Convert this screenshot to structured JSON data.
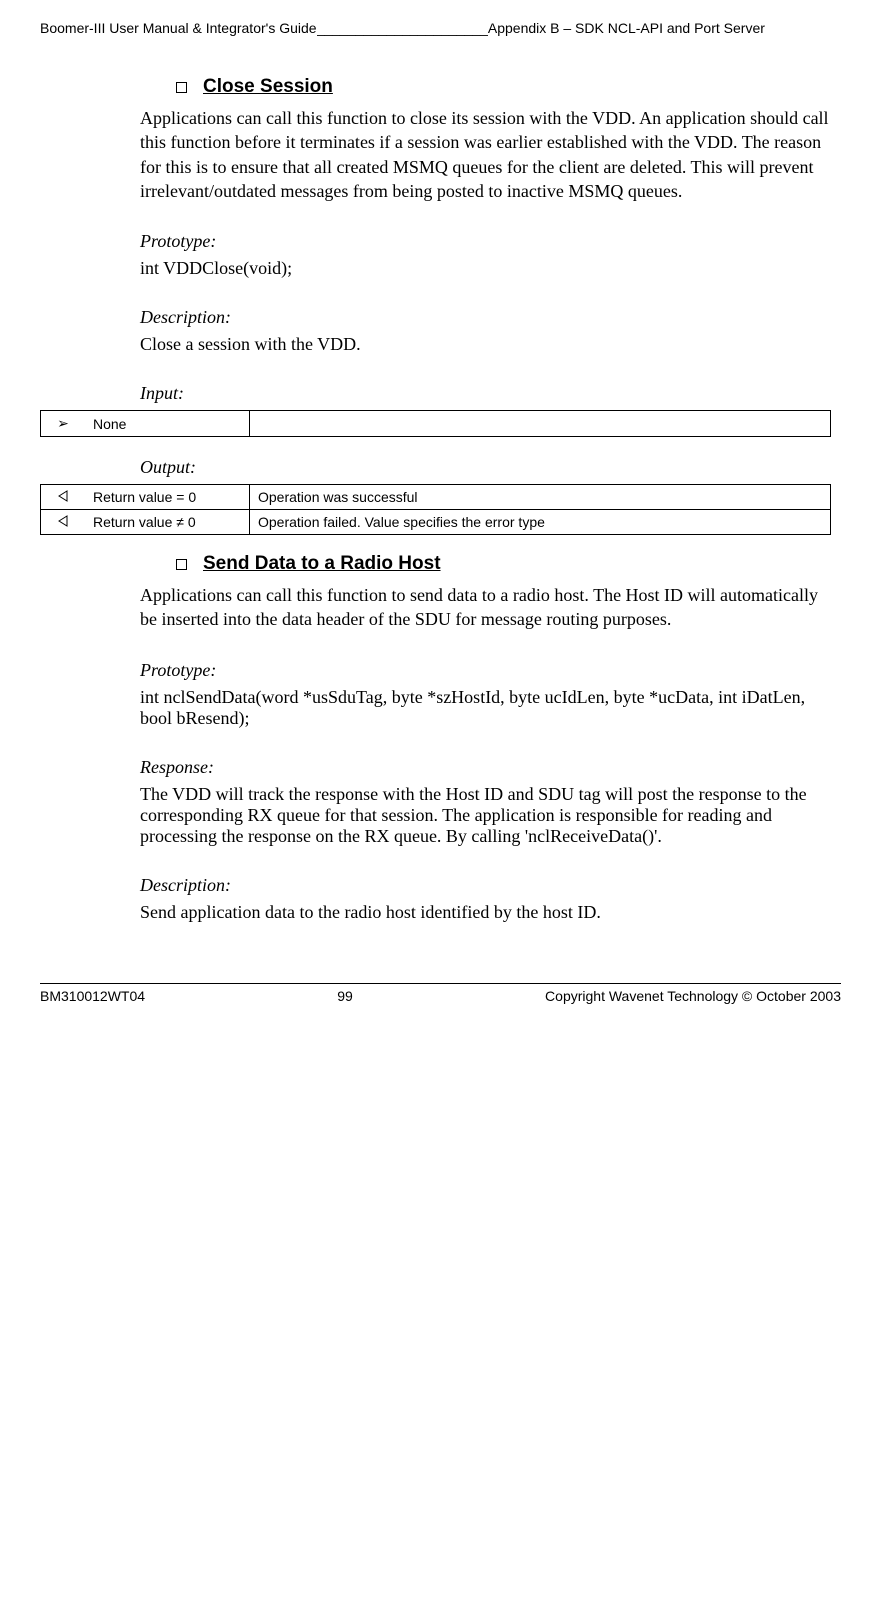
{
  "header": {
    "left": "Boomer-III User Manual & Integrator's Guide",
    "fill": "______________________",
    "right": "Appendix B – SDK NCL-API and Port Server"
  },
  "section1": {
    "title": "Close Session",
    "body": "Applications can call this function to close its session with the VDD. An application should call this function before it terminates if a session was earlier established with the VDD.  The reason for this is to ensure that all created MSMQ queues for the client are deleted. This will prevent irrelevant/outdated messages from being posted to inactive MSMQ queues.",
    "prototype_label": "Prototype:",
    "prototype": "int VDDClose(void);",
    "description_label": "Description:",
    "description": "Close a session with the VDD.",
    "input_label": "Input",
    "output_label": "Output",
    "input_rows": [
      {
        "arrow": "➢",
        "key": "None",
        "val": ""
      }
    ],
    "output_rows": [
      {
        "arrow": "",
        "key": "Return value = 0",
        "val": "Operation was successful"
      },
      {
        "arrow": "",
        "key": "Return value  ≠ 0",
        "val": "Operation failed. Value specifies the error type"
      }
    ]
  },
  "section2": {
    "title": "Send Data to a Radio Host",
    "body": "Applications can call this function to send data to a radio host. The Host ID will automatically be inserted into the data header of the SDU for message routing purposes.",
    "prototype_label": "Prototype:",
    "prototype": "int nclSendData(word *usSduTag, byte *szHostId, byte ucIdLen, byte *ucData, int iDatLen, bool bResend);",
    "response_label": "Response",
    "response": "The VDD will track the response with the Host ID and SDU tag will post the response to the corresponding RX queue for that session. The application is responsible for reading and processing the response on the RX queue. By calling 'nclReceiveData()'.",
    "description_label": "Description:",
    "description": "Send application data to the radio host identified by the host ID."
  },
  "footer": {
    "left": "BM310012WT04",
    "center": "99",
    "right": "Copyright Wavenet Technology © October 2003"
  }
}
